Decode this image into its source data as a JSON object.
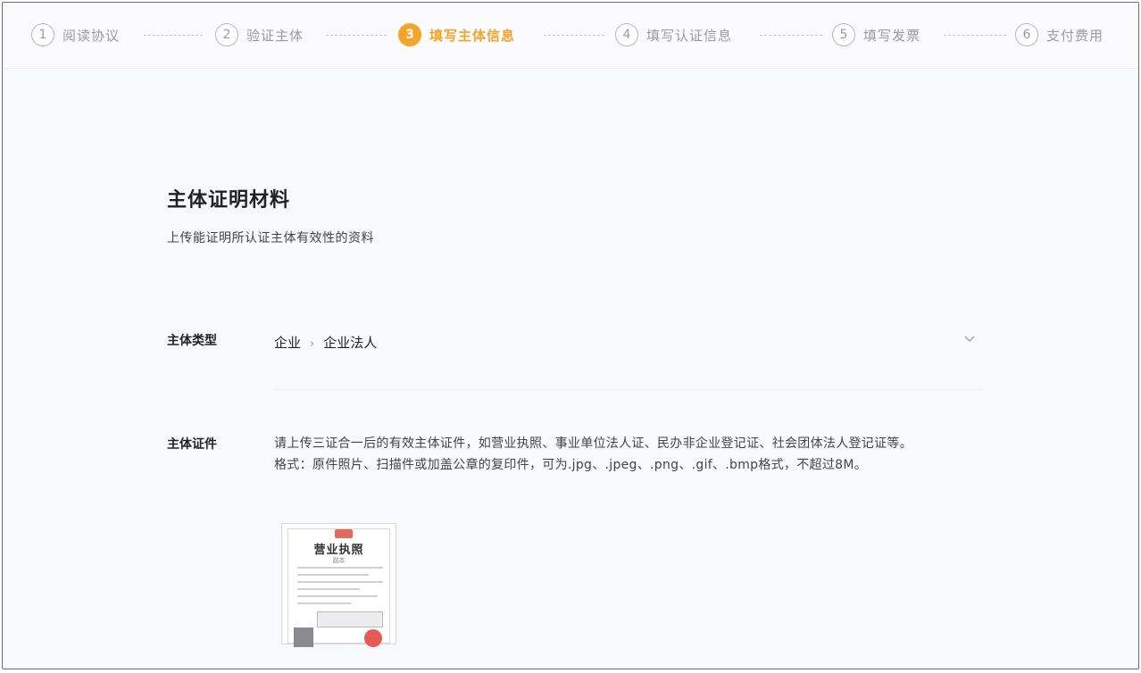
{
  "steps": [
    {
      "num": "1",
      "label": "阅读协议",
      "active": false
    },
    {
      "num": "2",
      "label": "验证主体",
      "active": false
    },
    {
      "num": "3",
      "label": "填写主体信息",
      "active": true
    },
    {
      "num": "4",
      "label": "填写认证信息",
      "active": false
    },
    {
      "num": "5",
      "label": "填写发票",
      "active": false
    },
    {
      "num": "6",
      "label": "支付费用",
      "active": false
    }
  ],
  "section": {
    "title": "主体证明材料",
    "description": "上传能证明所认证主体有效性的资料"
  },
  "subject_type": {
    "label": "主体类型",
    "level1": "企业",
    "separator": "›",
    "level2": "企业法人",
    "chevron_icon": "chevron-down-icon"
  },
  "subject_certificate": {
    "label": "主体证件",
    "line1": "请上传三证合一后的有效主体证件，如营业执照、事业单位法人证、民办非企业登记证、社会团体法人登记证等。",
    "line2": "格式：原件照片、扫描件或加盖公章的复印件，可为.jpg、.jpeg、.png、.gif、.bmp格式，不超过8M。",
    "thumbnail": {
      "title": "营业执照",
      "subtitle": "副本"
    }
  },
  "colors": {
    "accent": "#f5a42a",
    "border": "#6f6a7a",
    "seal": "#e35b52"
  }
}
